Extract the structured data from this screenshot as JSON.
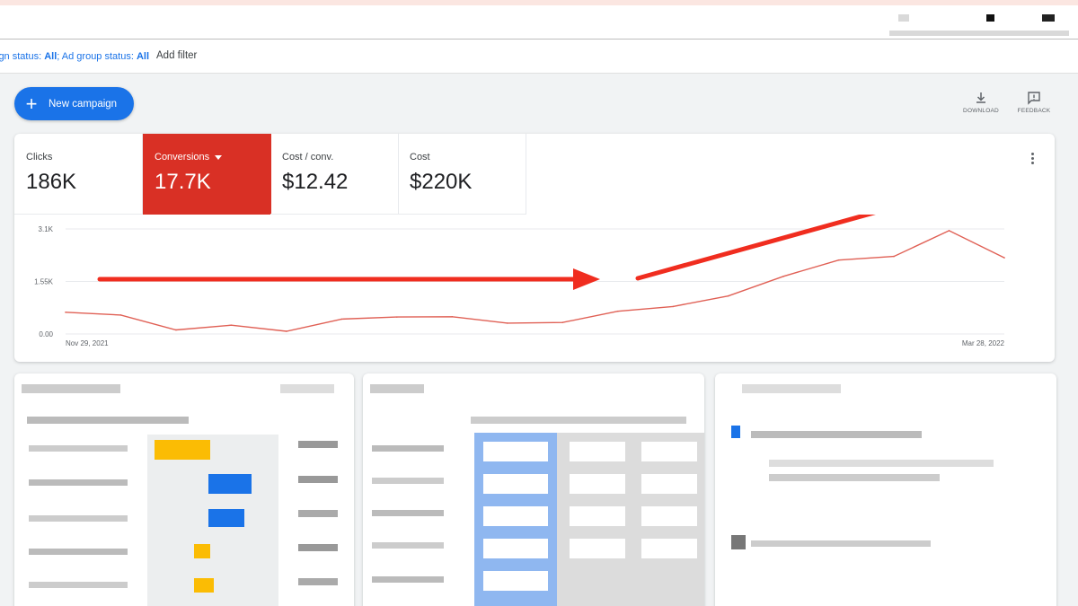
{
  "filter": {
    "campaign_status_label": "ign status:",
    "campaign_status_value": "All",
    "separator": ";",
    "ad_group_status_label": "Ad group status:",
    "ad_group_status_value": "All",
    "add_filter": "Add filter"
  },
  "actions": {
    "new_campaign": "New campaign",
    "download": "DOWNLOAD",
    "feedback": "FEEDBACK"
  },
  "metrics": [
    {
      "label": "Clicks",
      "value": "186K"
    },
    {
      "label": "Conversions",
      "value": "17.7K"
    },
    {
      "label": "Cost / conv.",
      "value": "$12.42"
    },
    {
      "label": "Cost",
      "value": "$220K"
    }
  ],
  "colors": {
    "accent": "#1a73e8",
    "selected_metric": "#d93025",
    "series_line": "#e06055",
    "annotation_arrow": "#f02d1f"
  },
  "chart_data": {
    "type": "line",
    "series": [
      {
        "name": "Conversions",
        "values": [
          640,
          560,
          120,
          260,
          80,
          440,
          500,
          510,
          320,
          340,
          670,
          810,
          1120,
          1700,
          2180,
          2290,
          3050,
          2250
        ]
      }
    ],
    "x_start_label": "Nov 29, 2021",
    "x_end_label": "Mar 28, 2022",
    "y_ticks": [
      "0.00",
      "1.55K",
      "3.1K"
    ],
    "ylim": [
      0,
      3100
    ],
    "grid": true,
    "annotations": [
      "flat arrow",
      "rising arrow"
    ]
  }
}
